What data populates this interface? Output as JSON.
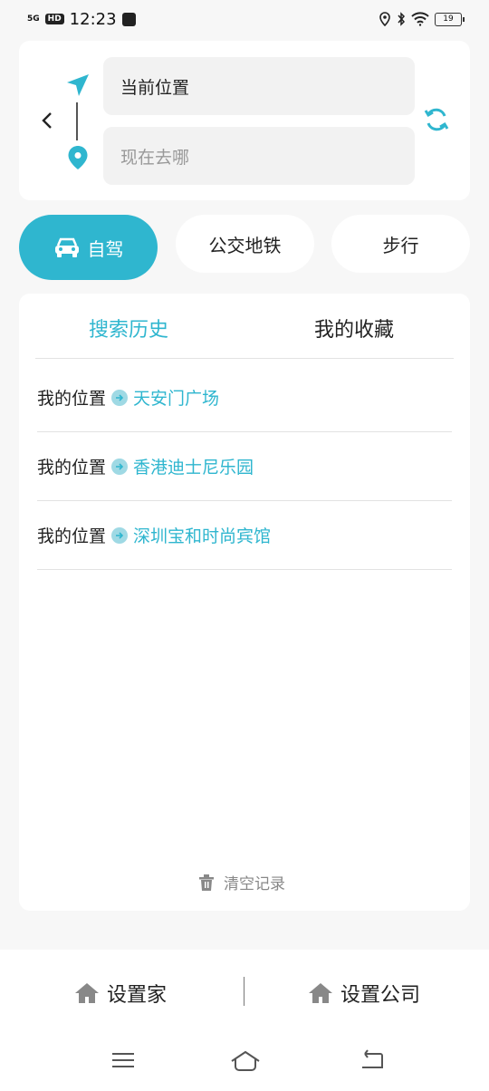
{
  "status_bar": {
    "network": "5G",
    "hd": "HD",
    "time": "12:23",
    "battery": "19"
  },
  "route": {
    "from_value": "当前位置",
    "to_placeholder": "现在去哪"
  },
  "modes": {
    "drive": "自驾",
    "transit": "公交地铁",
    "walk": "步行"
  },
  "tabs": {
    "history": "搜索历史",
    "favorites": "我的收藏"
  },
  "history": [
    {
      "from": "我的位置",
      "to": "天安门广场"
    },
    {
      "from": "我的位置",
      "to": "香港迪士尼乐园"
    },
    {
      "from": "我的位置",
      "to": "深圳宝和时尚宾馆"
    }
  ],
  "clear_label": "清空记录",
  "bottom": {
    "home": "设置家",
    "work": "设置公司"
  },
  "colors": {
    "accent": "#2fb6cf",
    "background": "#f7f7f7"
  }
}
